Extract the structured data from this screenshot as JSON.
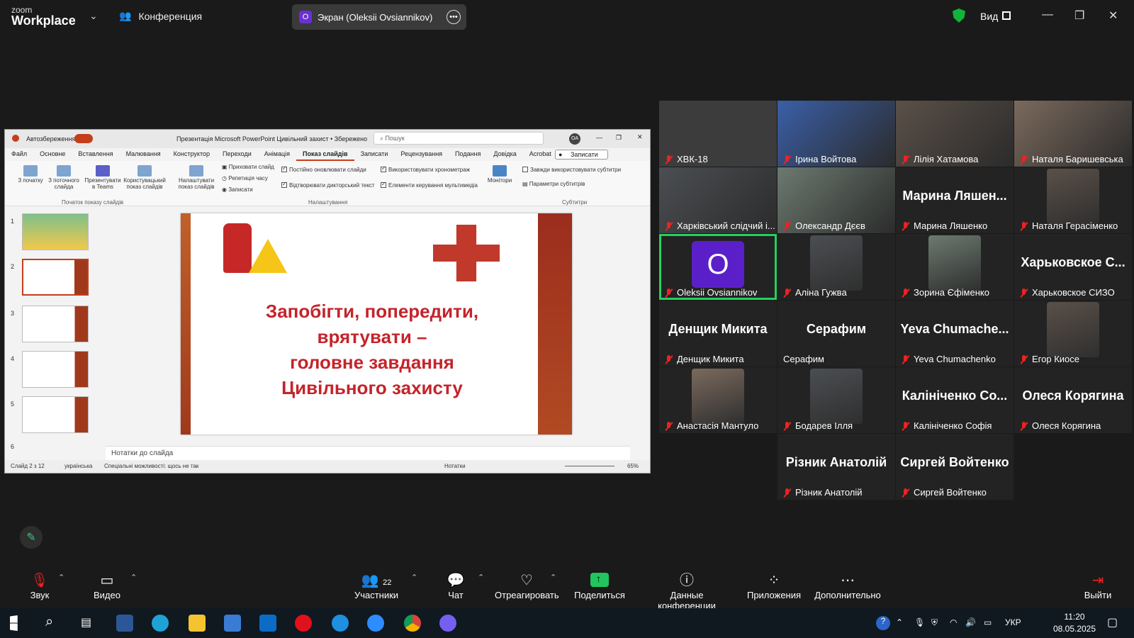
{
  "topbar": {
    "logo_small": "zoom",
    "logo_big": "Workplace",
    "conference": "Конференция",
    "screen_initial": "O",
    "screen_label": "Экран (Oleksii Ovsiannikov)",
    "view_label": "Вид"
  },
  "ppt": {
    "autosave": "Автозбереження",
    "doc_title": "Презентація Microsoft PowerPoint Цивільний захист • Збережено",
    "search_placeholder": "Пошук",
    "user_initials": "OA",
    "menu": [
      "Файл",
      "Основне",
      "Вставлення",
      "Малювання",
      "Конструктор",
      "Переходи",
      "Анімація",
      "Показ слайдів",
      "Записати",
      "Рецензування",
      "Подання",
      "Довідка",
      "Acrobat"
    ],
    "record_btn": "Записати",
    "ribbon": {
      "from_start": "З початку",
      "from_current": "З поточного слайда",
      "teams": "Презентувати в Teams",
      "custom": "Користувацький показ слайдів",
      "setup": "Налаштувати показ слайдів",
      "hide": "Приховати слайд",
      "rehearse": "Репетиція часу",
      "record": "Записати",
      "update": "Постійно оновлювати слайди",
      "restore": "Відтворювати дикторський текст",
      "timing": "Використовувати хронометраж",
      "media": "Елементи керування мультимедіа",
      "monitors": "Монітори",
      "always_subs": "Завжди використовувати субтитри",
      "sub_params": "Параметри субтитрів",
      "grp_start": "Початок показу слайдів",
      "grp_setup": "Налаштування",
      "grp_subs": "Субтитри"
    },
    "thumb_numbers": [
      "1",
      "2",
      "3",
      "4",
      "5",
      "6"
    ],
    "slide_lines": [
      "Запобігти, попередити,",
      "врятувати –",
      "головне завдання",
      "Цивільного захисту"
    ],
    "notes": "Нотатки до слайда",
    "status_slide": "Слайд 2 з 12",
    "status_lang": "українська",
    "status_access": "Спеціальні можливості: щось не так",
    "status_notes": "Нотатки",
    "zoom": "65%"
  },
  "gallery": [
    {
      "name": "ХВК-18",
      "big": "",
      "kind": "dark"
    },
    {
      "name": "Ірина Войтова",
      "big": "",
      "kind": "video"
    },
    {
      "name": "Лілія Хатамова",
      "big": "",
      "kind": "video"
    },
    {
      "name": "Наталя Баришевська",
      "big": "",
      "kind": "video"
    },
    {
      "name": "Харківський слідчий і...",
      "big": "",
      "kind": "video"
    },
    {
      "name": "Олександр Дєєв",
      "big": "",
      "kind": "video"
    },
    {
      "name": "Марина Ляшенко",
      "big": "Марина Ляшен...",
      "kind": "text"
    },
    {
      "name": "Наталя Герасіменко",
      "big": "",
      "kind": "portrait"
    },
    {
      "name": "Oleksii Ovsiannikov",
      "big": "O",
      "kind": "avatar"
    },
    {
      "name": "Аліна Гужва",
      "big": "",
      "kind": "portrait"
    },
    {
      "name": "Зорина Єфіменко",
      "big": "",
      "kind": "portrait"
    },
    {
      "name": "Харьковское СИЗО",
      "big": "Харьковское С...",
      "kind": "text"
    },
    {
      "name": "Денщик Микита",
      "big": "Денщик Микита",
      "kind": "text"
    },
    {
      "name": "Серафим",
      "big": "Серафим",
      "kind": "text"
    },
    {
      "name": "Yeva Chumachenko",
      "big": "Yeva Chumache...",
      "kind": "text"
    },
    {
      "name": "Егор Киосе",
      "big": "",
      "kind": "portrait"
    },
    {
      "name": "Анастасія Мантуло",
      "big": "",
      "kind": "portrait"
    },
    {
      "name": "Бодарев Ілля",
      "big": "",
      "kind": "portrait"
    },
    {
      "name": "Калініченко Софія",
      "big": "Калініченко Со...",
      "kind": "text"
    },
    {
      "name": "Олеся Корягина",
      "big": "Олеся Корягина",
      "kind": "text"
    },
    {
      "name": "Різник Анатолій",
      "big": "Різник Анатолій",
      "kind": "text"
    },
    {
      "name": "Сиргей Войтенко",
      "big": "Сиргей Войтенко",
      "kind": "text"
    }
  ],
  "toolbar": {
    "audio": "Звук",
    "video": "Видео",
    "participants": "Участники",
    "participants_count": "22",
    "chat": "Чат",
    "react": "Отреагировать",
    "share": "Поделиться",
    "info": "Данные конференции",
    "apps": "Приложения",
    "more": "Дополнительно",
    "leave": "Выйти"
  },
  "taskbar": {
    "lang": "УКР",
    "time": "11:20",
    "date": "08.05.2025"
  },
  "colors": {
    "accent_green": "#23d160",
    "mute_red": "#e22222",
    "slide_red": "#c4242b",
    "avatar_purple": "#5b1fc9"
  }
}
